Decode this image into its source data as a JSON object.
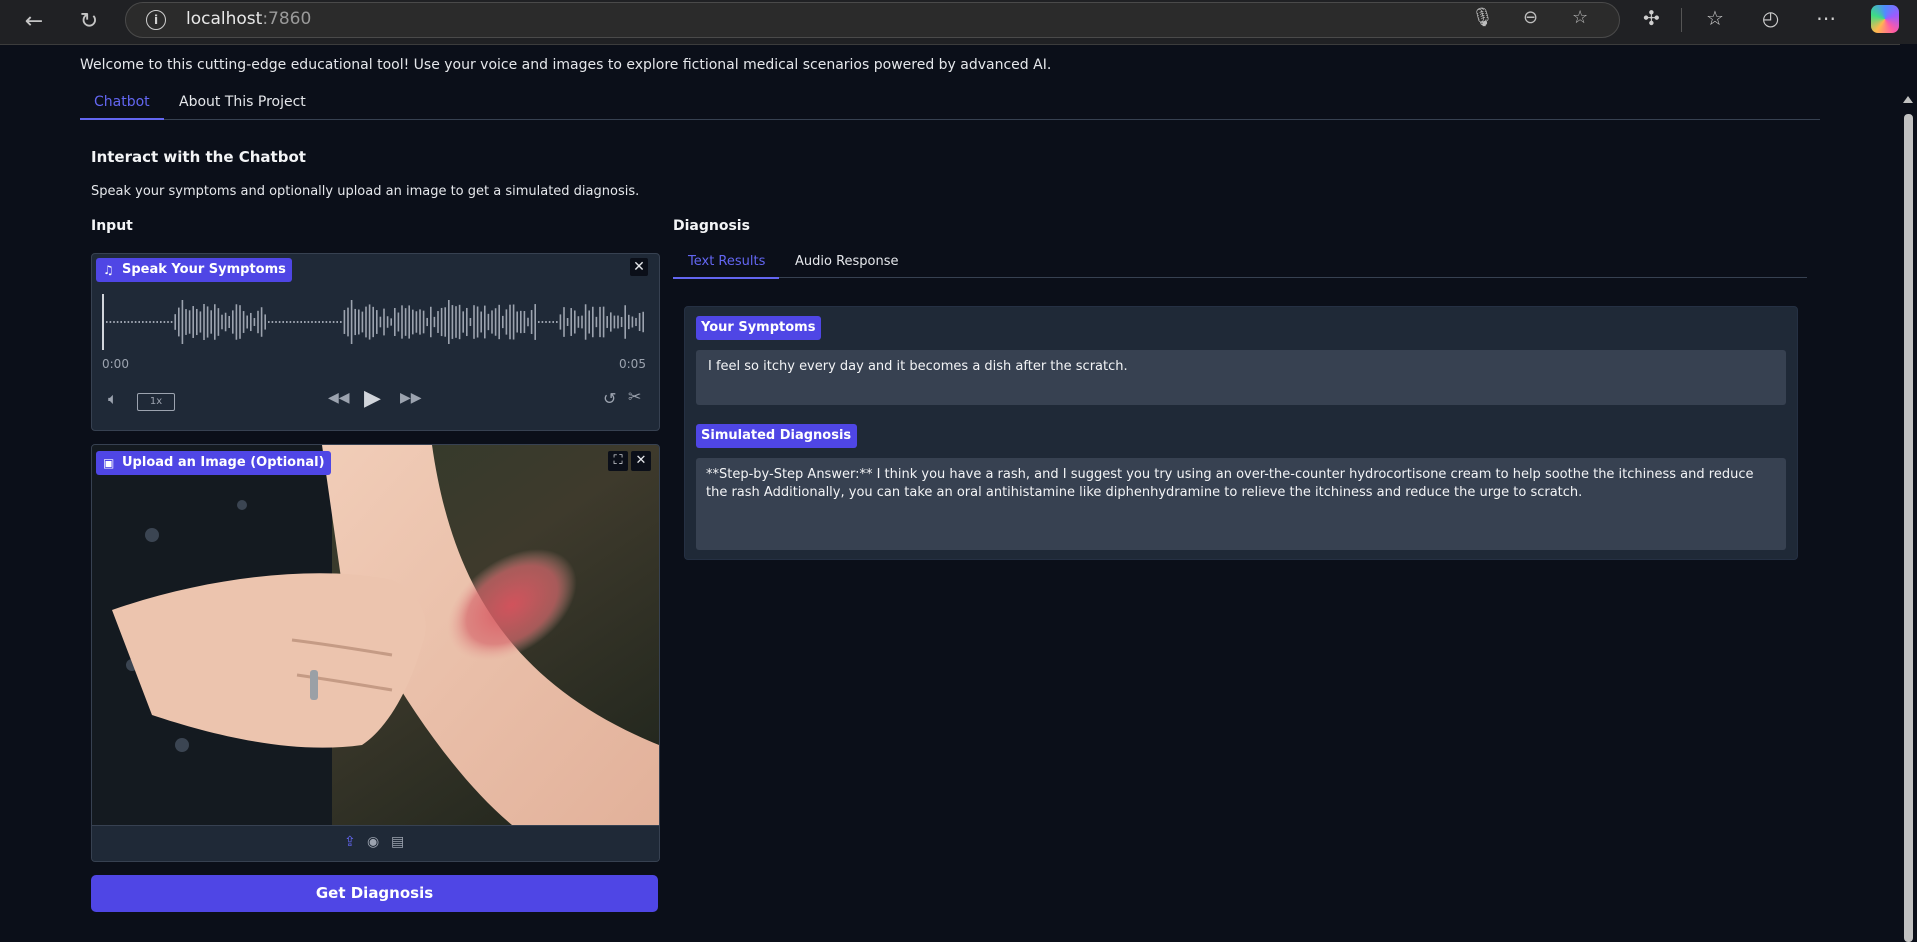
{
  "browser": {
    "url_host": "localhost",
    "url_port": ":7860"
  },
  "welcome": "Welcome to this cutting-edge educational tool! Use your voice and images to explore fictional medical scenarios powered by advanced AI.",
  "main_tabs": [
    {
      "label": "Chatbot",
      "active": true
    },
    {
      "label": "About This Project",
      "active": false
    }
  ],
  "chatbot": {
    "heading": "Interact with the Chatbot",
    "description": "Speak your symptoms and optionally upload an image to get a simulated diagnosis.",
    "input_heading": "Input",
    "audio": {
      "label": "Speak Your Symptoms",
      "time_start": "0:00",
      "time_end": "0:05",
      "speed": "1x"
    },
    "image": {
      "label": "Upload an Image (Optional)"
    },
    "submit_label": "Get Diagnosis"
  },
  "diagnosis": {
    "heading": "Diagnosis",
    "tabs": [
      {
        "label": "Text Results",
        "active": true
      },
      {
        "label": "Audio Response",
        "active": false
      }
    ],
    "symptoms_label": "Your Symptoms",
    "symptoms_text": "I feel so itchy every day and it becomes a dish after the scratch.",
    "diagnosis_label": "Simulated Diagnosis",
    "diagnosis_text": "**Step-by-Step Answer:** I think you have a rash, and I suggest you try using an over-the-counter hydrocortisone cream to help soothe the itchiness and reduce the rash Additionally, you can take an oral antihistamine like diphenhydramine to relieve the itchiness and reduce the urge to scratch."
  },
  "colors": {
    "accent": "#4f46e5",
    "background": "#0b0f19",
    "panel": "#1f2937"
  }
}
